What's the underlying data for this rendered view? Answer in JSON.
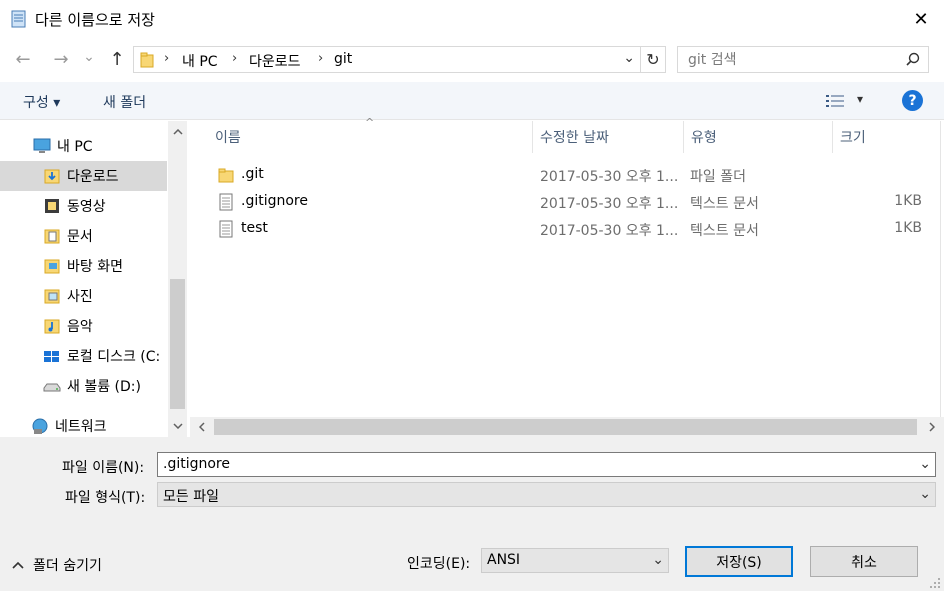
{
  "window": {
    "title": "다른 이름으로 저장",
    "close_glyph": "✕"
  },
  "nav": {
    "back_glyph": "←",
    "forward_glyph": "→",
    "recent_glyph": "⌄",
    "up_glyph": "↑",
    "breadcrumb": [
      "내 PC",
      "다운로드",
      "git"
    ],
    "breadcrumb_sep": "›",
    "refresh_glyph": "↻"
  },
  "search": {
    "placeholder": "git 검색"
  },
  "toolbar": {
    "organize": "구성 ▾",
    "new_folder": "새 폴더",
    "view_menu_glyph": "▾",
    "help": "?"
  },
  "sidebar": {
    "items": [
      {
        "label": "내 PC",
        "icon": "pc-icon"
      },
      {
        "label": "다운로드",
        "icon": "download-folder-icon"
      },
      {
        "label": "동영상",
        "icon": "video-folder-icon"
      },
      {
        "label": "문서",
        "icon": "documents-folder-icon"
      },
      {
        "label": "바탕 화면",
        "icon": "desktop-folder-icon"
      },
      {
        "label": "사진",
        "icon": "pictures-folder-icon"
      },
      {
        "label": "음악",
        "icon": "music-folder-icon"
      },
      {
        "label": "로컬 디스크 (C:",
        "icon": "windows-drive-icon"
      },
      {
        "label": "새 볼륨 (D:)",
        "icon": "drive-icon"
      },
      {
        "label": "네트워크",
        "icon": "network-icon"
      }
    ]
  },
  "file_list": {
    "columns": [
      "이름",
      "수정한 날짜",
      "유형",
      "크기"
    ],
    "sort_glyph": "^",
    "rows": [
      {
        "name": ".git",
        "date": "2017-05-30 오후 1...",
        "type": "파일 폴더",
        "size": "",
        "icon": "folder-icon"
      },
      {
        "name": ".gitignore",
        "date": "2017-05-30 오후 1...",
        "type": "텍스트 문서",
        "size": "1KB",
        "icon": "text-file-icon"
      },
      {
        "name": "test",
        "date": "2017-05-30 오후 1...",
        "type": "텍스트 문서",
        "size": "1KB",
        "icon": "text-file-icon"
      }
    ]
  },
  "form": {
    "filename_label": "파일 이름(N):",
    "filename_value": ".gitignore",
    "filetype_label": "파일 형식(T):",
    "filetype_value": "모든 파일",
    "encoding_label": "인코딩(E):",
    "encoding_value": "ANSI",
    "dropdown_glyph": "⌄"
  },
  "footer": {
    "hide_folders": "폴더 숨기기",
    "hide_folders_glyph": "⌃",
    "save": "저장(S)",
    "cancel": "취소"
  },
  "colors": {
    "accent": "#0078d7",
    "help_blue": "#1a73d6",
    "selected_bg": "#d9d9d9"
  }
}
